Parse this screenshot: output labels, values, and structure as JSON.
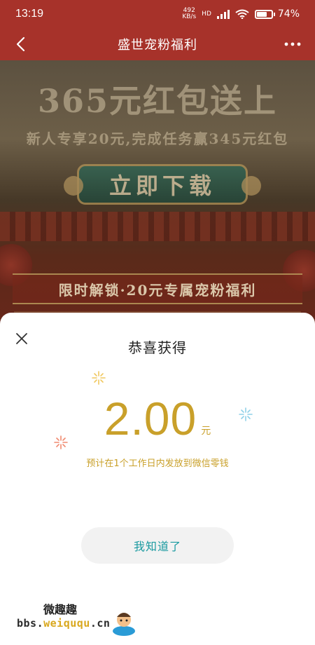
{
  "status_bar": {
    "time": "13:19",
    "net_speed_value": "492",
    "net_speed_unit": "KB/s",
    "hd": "HD",
    "battery_percent": "74%",
    "battery_level": 0.74
  },
  "nav": {
    "title": "盛世宠粉福利"
  },
  "banner": {
    "big_title": "365元红包送上",
    "subtitle": "新人专享20元,完成任务赢345元红包",
    "download_button": "立即下载",
    "unlock_text": "限时解锁·20元专属宠粉福利"
  },
  "modal": {
    "title": "恭喜获得",
    "amount": "2.00",
    "unit": "元",
    "note": "预计在1个工作日内发放到微信零钱",
    "confirm_button": "我知道了"
  },
  "watermark": {
    "top_text": "微趣趣",
    "url_prefix": "bbs.",
    "url_brand": "weiququ",
    "url_suffix": ".cn"
  },
  "colors": {
    "header_red": "#a7322a",
    "amount_gold": "#c9a02a",
    "button_teal": "#1a9aa0"
  }
}
